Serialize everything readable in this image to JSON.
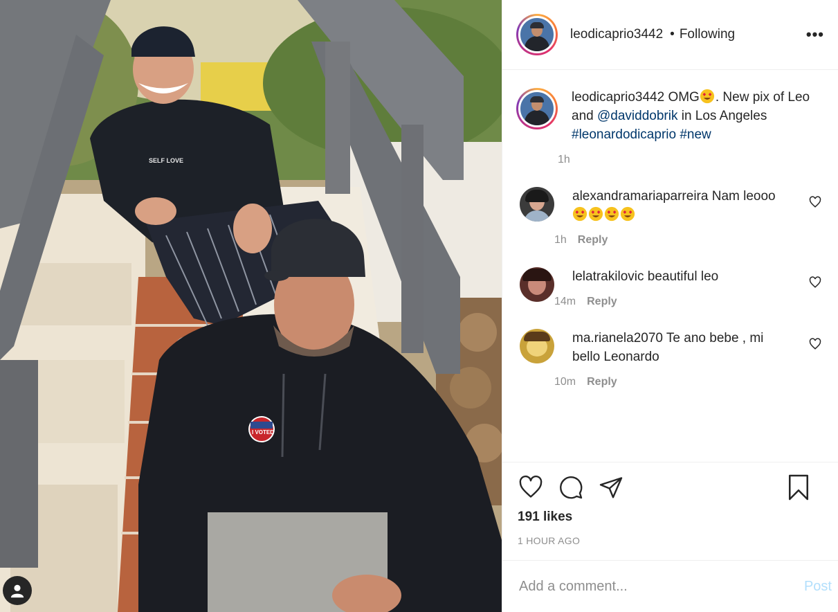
{
  "post": {
    "author": "leodicaprio3442",
    "separator": "•",
    "follow_status": "Following",
    "more_label": "•••",
    "caption": {
      "username": "leodicaprio3442",
      "text_1": "OMG",
      "text_2": ". New pix of Leo and ",
      "mention": "@daviddobrik",
      "text_3": " in Los Angeles",
      "hashtag_1": "#leonardodicaprio",
      "hashtag_2": "#new",
      "time": "1h"
    },
    "likes": "191 likes",
    "time_ago": "1 HOUR AGO"
  },
  "comments": [
    {
      "username": "alexandramariaparreira",
      "text": "Nam leooo",
      "emoji_count": 4,
      "time": "1h",
      "reply": "Reply",
      "avatar_color": "#3b3b3b"
    },
    {
      "username": "lelatrakilovic",
      "text": "beautiful leo",
      "time": "14m",
      "reply": "Reply",
      "avatar_color": "#5a2f2a"
    },
    {
      "username": "ma.rianela2070",
      "text": "Te ano bebe , mi bello Leonardo",
      "time": "10m",
      "reply": "Reply",
      "avatar_color": "#c9a23a"
    }
  ],
  "add_comment": {
    "placeholder": "Add a comment...",
    "post_label": "Post"
  },
  "icons": {
    "like": "heart-icon",
    "comment": "comment-icon",
    "share": "paper-plane-icon",
    "save": "bookmark-icon",
    "user_tags": "user-icon"
  },
  "colors": {
    "link": "#00376b",
    "muted": "#8e8e8e",
    "post_button": "#b2dffc"
  }
}
